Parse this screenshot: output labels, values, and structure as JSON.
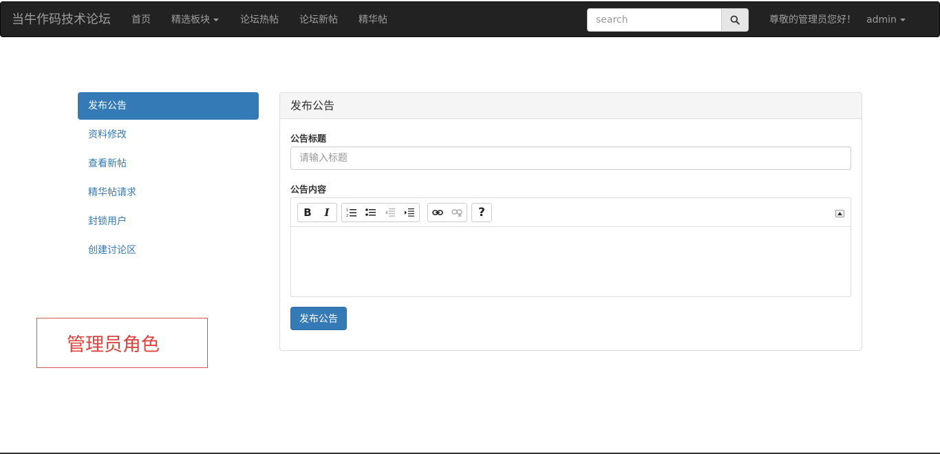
{
  "navbar": {
    "brand": "当牛作码技术论坛",
    "items": [
      {
        "label": "首页"
      },
      {
        "label": "精选板块"
      },
      {
        "label": "论坛热帖"
      },
      {
        "label": "论坛新帖"
      },
      {
        "label": "精华帖"
      }
    ],
    "search": {
      "placeholder": "search",
      "value": ""
    },
    "greeting": "尊敬的管理员您好！",
    "user": "admin"
  },
  "sidebar": {
    "items": [
      {
        "label": "发布公告",
        "active": true
      },
      {
        "label": "资料修改"
      },
      {
        "label": "查看新帖"
      },
      {
        "label": "精华帖请求"
      },
      {
        "label": "封锁用户"
      },
      {
        "label": "创建讨论区"
      }
    ]
  },
  "annotation": {
    "label": "管理员角色",
    "color": "#e0433e"
  },
  "panel": {
    "heading": "发布公告",
    "title_label": "公告标题",
    "title_placeholder": "请输入标题",
    "title_value": "",
    "content_label": "公告内容",
    "toolbar": [
      "bold-icon",
      "italic-icon",
      "ordered-list-icon",
      "unordered-list-icon",
      "outdent-icon",
      "indent-icon",
      "link-icon",
      "unlink-icon",
      "help-icon"
    ],
    "submit_label": "发布公告"
  },
  "colors": {
    "primary": "#337ab7",
    "navbar": "#222222",
    "annotation": "#e0433e"
  }
}
